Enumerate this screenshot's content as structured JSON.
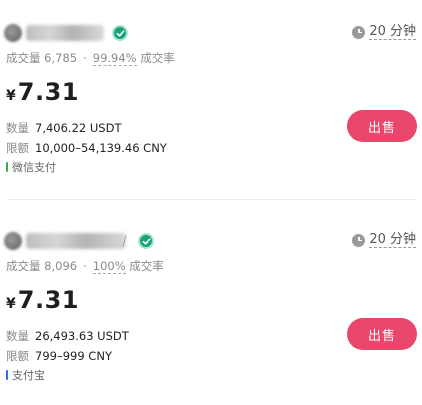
{
  "colors": {
    "accent": "#e8466a",
    "verified": "#1aa37a",
    "wechat": "#2bb24c",
    "alipay": "#2f6fe4"
  },
  "listings": [
    {
      "volume_label": "成交量",
      "volume": "6,785",
      "separator": "·",
      "completion": "99.94%",
      "completion_label": "成交率",
      "time_limit": "20 分钟",
      "currency_symbol": "¥",
      "price": "7.31",
      "quantity_label": "数量",
      "quantity": "7,406.22 USDT",
      "limit_label": "限额",
      "limit": "10,000–54,139.46 CNY",
      "payment_method": "微信支付",
      "payment_icon": "wechat-pay",
      "action_label": "出售"
    },
    {
      "volume_label": "成交量",
      "volume": "8,096",
      "separator": "·",
      "completion": "100%",
      "completion_label": "成交率",
      "time_limit": "20 分钟",
      "currency_symbol": "¥",
      "price": "7.31",
      "quantity_label": "数量",
      "quantity": "26,493.63 USDT",
      "limit_label": "限额",
      "limit": "799–999 CNY",
      "payment_method": "支付宝",
      "payment_icon": "alipay",
      "action_label": "出售"
    }
  ]
}
